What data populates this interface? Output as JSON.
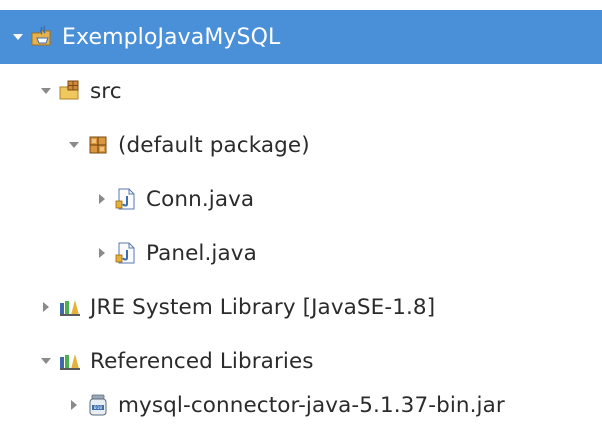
{
  "tree": {
    "project": {
      "label": "ExemploJavaMySQL",
      "icon": "java-project-icon",
      "expanded": true,
      "selected": true
    },
    "src": {
      "label": "src",
      "icon": "source-folder-icon",
      "expanded": true
    },
    "default_package": {
      "label": "(default package)",
      "icon": "package-icon",
      "expanded": true
    },
    "conn": {
      "label": "Conn.java",
      "icon": "java-file-icon",
      "expanded": false
    },
    "panel": {
      "label": "Panel.java",
      "icon": "java-file-icon",
      "expanded": false
    },
    "jre": {
      "label": "JRE System Library [JavaSE-1.8]",
      "icon": "library-icon",
      "expanded": false
    },
    "ref_libs": {
      "label": "Referenced Libraries",
      "icon": "library-icon",
      "expanded": true
    },
    "mysql_jar": {
      "label": "mysql-connector-java-5.1.37-bin.jar",
      "icon": "jar-icon",
      "expanded": false
    }
  },
  "colors": {
    "selection": "#4a90d9",
    "text": "#2b2b2b",
    "arrow": "#7a7a7a"
  }
}
